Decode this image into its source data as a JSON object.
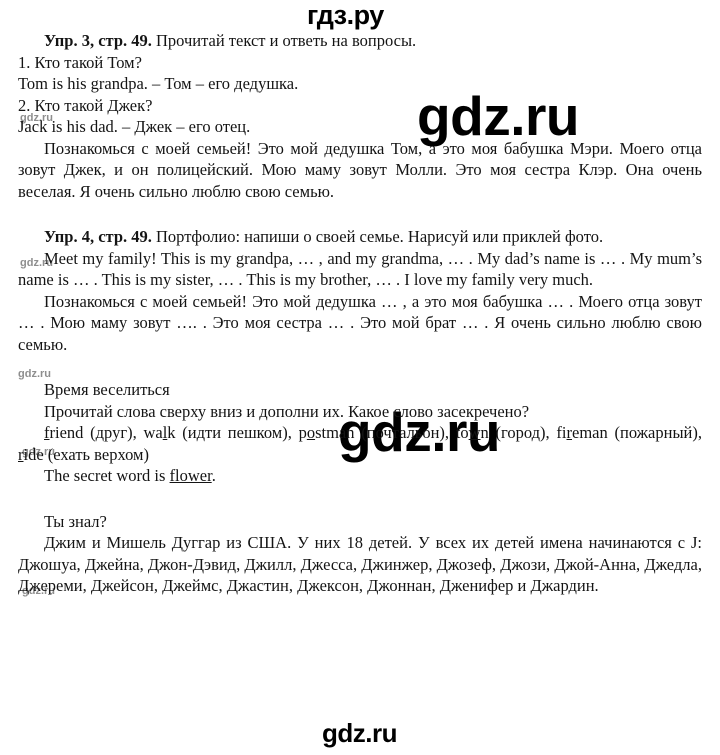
{
  "site": {
    "brand": "гдз.ру",
    "watermark": "gdz.ru",
    "watermark_small": "gdz.ru"
  },
  "exercises": [
    {
      "id": "ex3",
      "number_label": "Упр. 3, стр. 49.",
      "task": " Прочитай текст и ответь на вопросы.",
      "lines": [
        "1. Кто такой Том?",
        "Tom is his grandpa. – Том – его дедушка.",
        "2. Кто такой Джек?",
        "Jack is his dad. – Джек – его отец."
      ],
      "paragraph": "Познакомься с моей семьей! Это мой дедушка Том, а это моя бабушка Мэри. Моего отца зовут Джек, и он полицейский. Мою маму зовут Молли. Это моя сестра Клэр. Она очень веселая. Я очень сильно люблю свою семью."
    },
    {
      "id": "ex4",
      "number_label": "Упр. 4, стр. 49.",
      "task": " Портфолио: напиши о своей семье. Нарисуй или приклей фото.",
      "english_answer": "Meet my family! This is my grandpa, … , and my grandma, … . My dad’s name is … . My mum’s name is … . This is my sister, … . This is my brother, … . I love my family very much.",
      "russian_answer": "Познакомься с моей семьей! Это мой дедушка … , а это моя бабушка … . Моего отца зовут … . Мою маму зовут …. . Это моя сестра … . Это мой брат … . Я очень сильно люблю свою семью."
    }
  ],
  "fun_time": {
    "heading": "Время веселиться",
    "instruction": "Прочитай слова сверху вниз и дополни их. Какое слово засекречено?",
    "words": [
      {
        "pre": "",
        "letter": "f",
        "post": "riend",
        "translation": " (друг), "
      },
      {
        "pre": "wa",
        "letter": "l",
        "post": "k",
        "translation": " (идти пешком), "
      },
      {
        "pre": "p",
        "letter": "o",
        "post": "stman",
        "translation": " (почтальон), "
      },
      {
        "pre": "to",
        "letter": "w",
        "post": "n",
        "translation": " (город), "
      },
      {
        "pre": "fi",
        "letter": "r",
        "post": "eman",
        "translation": " (пожарный), "
      },
      {
        "pre": "",
        "letter": "r",
        "post": "ide",
        "translation": " (ехать верхом)"
      }
    ],
    "secret_prefix": "The secret word is ",
    "secret_word": "flower",
    "secret_suffix": "."
  },
  "did_you_know": {
    "heading": "Ты знал?",
    "text_before_names": "Джим и Мишель Дуггар из США. У них 18 детей. У всех их детей имена начинаются с J: ",
    "names": "Джошуа, Джейна, Джон-Дэвид, Джилл, Джесса, Джинжер, Джозеф, Джози, Джой-Анна, Джедла, Джереми, Джейсон, Джеймс, Джастин, Джексон, Джоннан, Дженифер и Джардин.",
    "full_text": "Джим и Мишель Дуггар из США. У них 18 детей. У всех их детей имена начинаются с J: Джошуа, Джейна, Джон-Дэвид, Джилл, Джесса, Джинжер, Джозеф, Джози, Джой-Анна, Джедла, Джереми, Джейсон, Джеймс, Джастин, Джексон, Джоннан, Дженифер и Джардин."
  },
  "colors": {
    "text": "#141414",
    "watermark": "#000000",
    "watermark_small": "#6f6f6f",
    "page_background": "#ffffff"
  }
}
